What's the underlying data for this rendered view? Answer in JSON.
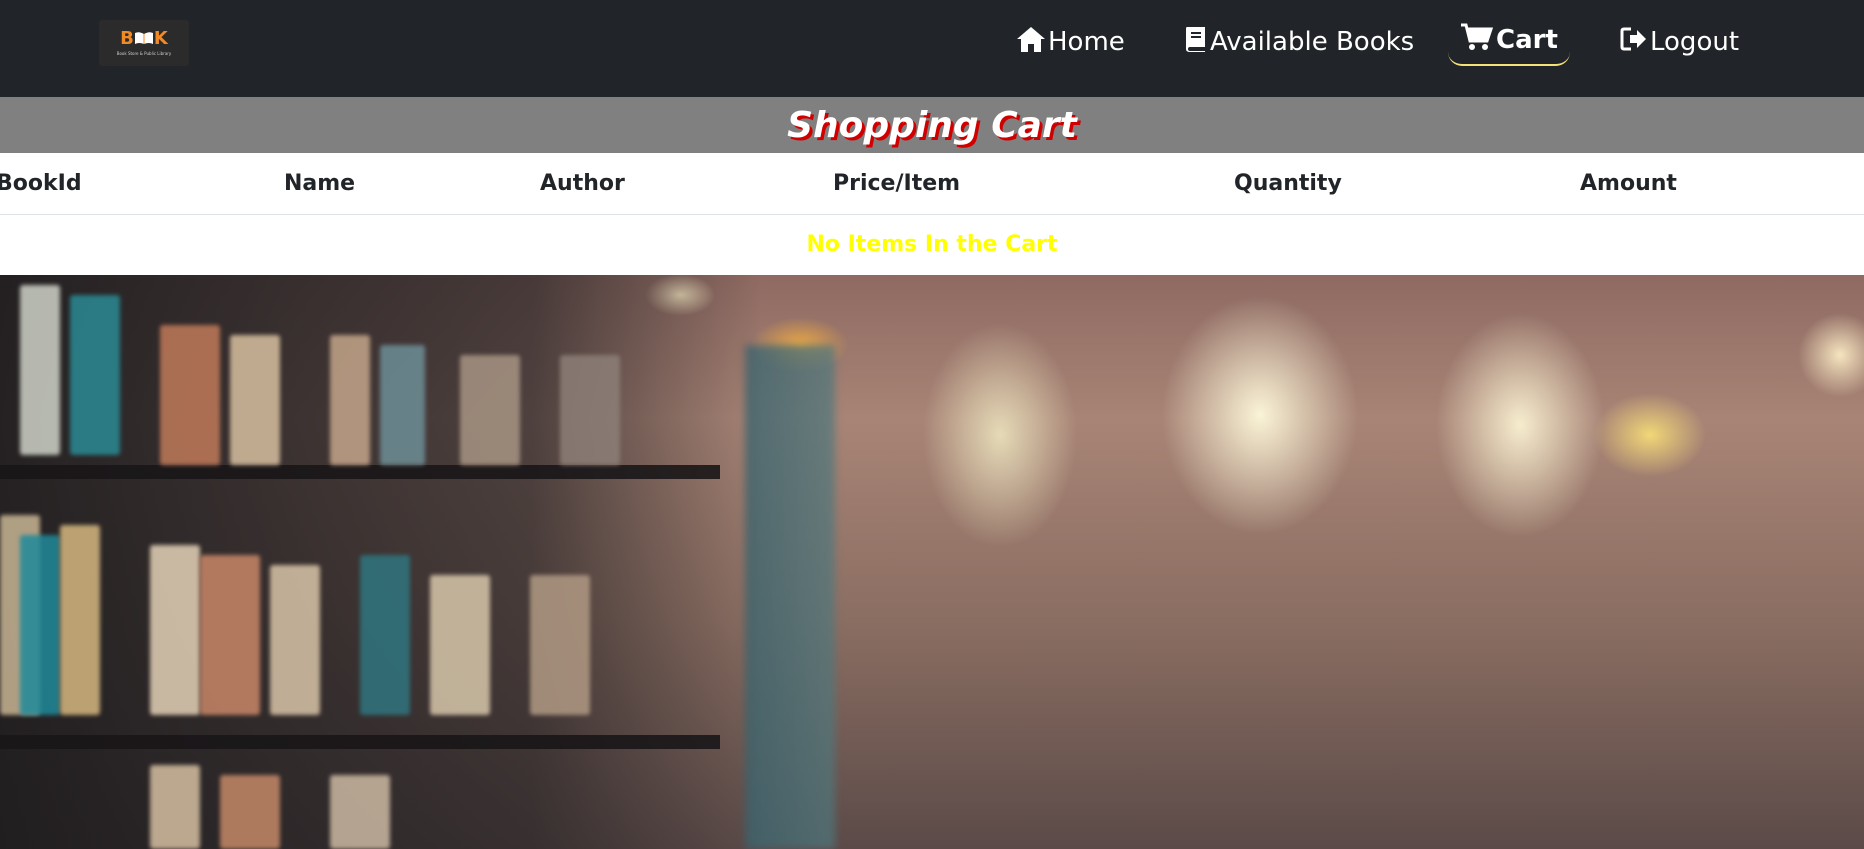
{
  "brand": {
    "word": "BOOK",
    "tagline": "Book Store & Public Library"
  },
  "nav": {
    "home": "Home",
    "available_books": "Available Books",
    "cart": "Cart",
    "logout": "Logout"
  },
  "page": {
    "title": "Shopping Cart"
  },
  "table": {
    "headers": [
      "BookId",
      "Name",
      "Author",
      "Price/Item",
      "Quantity",
      "Amount"
    ],
    "empty_message": "No Items In the Cart"
  },
  "colors": {
    "navbar": "#212529",
    "title_band": "#808080",
    "title_shadow": "#d10000",
    "empty_text": "#ffff00",
    "active_underline": "#f2e27a"
  },
  "icons": {
    "home": "house-icon",
    "available_books": "book-icon",
    "cart": "cart-icon",
    "logout": "logout-icon"
  }
}
